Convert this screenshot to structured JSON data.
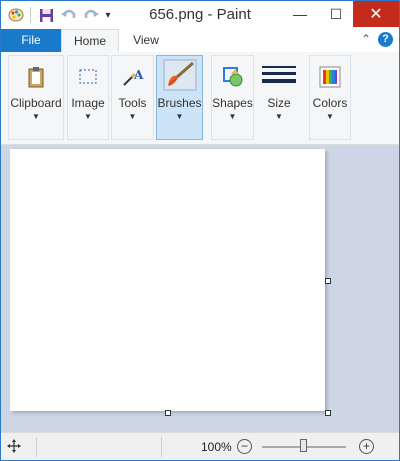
{
  "window": {
    "title": "656.png - Paint",
    "minimize_glyph": "—",
    "maximize_glyph": "☐",
    "close_glyph": "✕"
  },
  "quick_access": {
    "customize_glyph": "▾"
  },
  "tabs": [
    {
      "label": "File"
    },
    {
      "label": "Home"
    },
    {
      "label": "View"
    }
  ],
  "ribbon_controls": {
    "collapse_glyph": "⌃",
    "help_glyph": "?"
  },
  "ribbon": {
    "groups": [
      {
        "label": "Clipboard",
        "icon": "clipboard-icon"
      },
      {
        "label": "Image",
        "icon": "select-icon"
      },
      {
        "label": "Tools",
        "icon": "tools-icon"
      },
      {
        "label": "Brushes",
        "icon": "brush-icon",
        "selected": true
      },
      {
        "label": "Shapes",
        "icon": "shapes-icon"
      },
      {
        "label": "Size",
        "icon": "size-icon"
      },
      {
        "label": "Colors",
        "icon": "colors-icon"
      }
    ],
    "dropdown_glyph": "▼"
  },
  "status": {
    "zoom": "100%",
    "zoom_out_glyph": "−",
    "zoom_in_glyph": "+",
    "zoom_slider_fraction": 0.5
  },
  "colors": {
    "accent": "#1979ca",
    "ribbon_bg": "#f5f6f7",
    "workarea_bg": "#cdd6e5",
    "close_red": "#c42b1c",
    "selected_group": "#cce4f7"
  }
}
